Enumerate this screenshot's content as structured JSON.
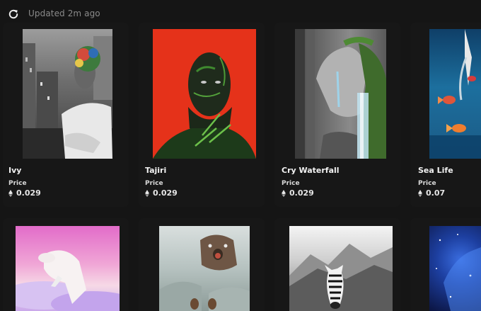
{
  "header": {
    "updated_text": "Updated 2m ago",
    "refresh_icon": "refresh-icon"
  },
  "price_label": "Price",
  "currency_icon": "ethereum-icon",
  "nfts": [
    {
      "title": "Ivy",
      "price": "0.029",
      "art": "woman-with-colorful-hair-bw-city"
    },
    {
      "title": "Tajiri",
      "price": "0.029",
      "art": "man-with-leaves-on-red"
    },
    {
      "title": "Cry Waterfall",
      "price": "0.029",
      "art": "face-with-waterfall"
    },
    {
      "title": "Sea Life",
      "price": "0.07",
      "art": "fish-underwater"
    },
    {
      "title": "",
      "price": "",
      "art": "polar-bear-pink-clouds"
    },
    {
      "title": "",
      "price": "",
      "art": "bear-in-fog"
    },
    {
      "title": "",
      "price": "",
      "art": "zebra-mountains-bw"
    },
    {
      "title": "",
      "price": "",
      "art": "blue-galaxy-hand"
    }
  ],
  "colors": {
    "background": "#151515",
    "muted_text": "#8a8a8a",
    "card_red": "#e5321a"
  }
}
